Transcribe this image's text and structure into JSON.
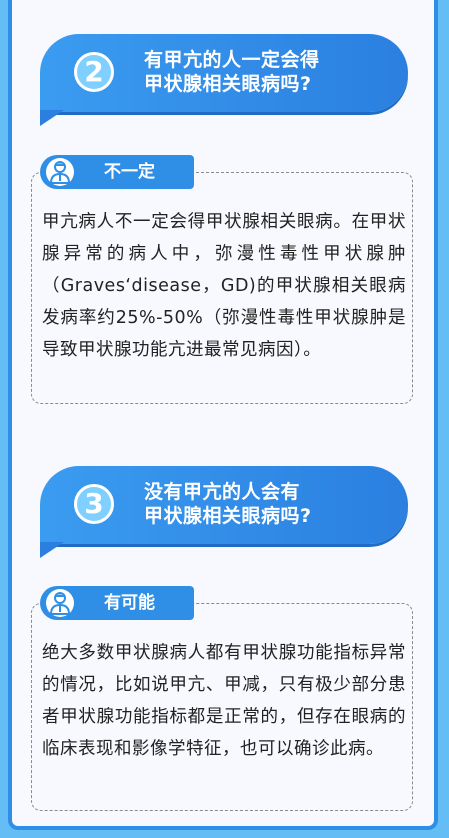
{
  "sections": [
    {
      "number": "2",
      "question_line1": "有甲亢的人一定会得",
      "question_line2": "甲状腺相关眼病吗?",
      "answer_tag": "不一定",
      "answer_text": "甲亢病人不一定会得甲状腺相关眼病。在甲状腺异常的病人中，弥漫性毒性甲状腺肿（Graves‘disease，GD)的甲状腺相关眼病发病率约25%-50%（弥漫性毒性甲状腺肿是导致甲状腺功能亢进最常见病因）。"
    },
    {
      "number": "3",
      "question_line1": "没有甲亢的人会有",
      "question_line2": "甲状腺相关眼病吗?",
      "answer_tag": "有可能",
      "answer_text": "绝大多数甲状腺病人都有甲状腺功能指标异常的情况，比如说甲亢、甲减，只有极少部分患者甲状腺功能指标都是正常的，但存在眼病的临床表现和影像学特征，也可以确诊此病。"
    }
  ],
  "icons": {
    "tag_icon": "doctor-icon"
  },
  "colors": {
    "primary": "#2f8fe6",
    "background": "#65bdf6",
    "panel": "#f7f9fe",
    "number_circle": "#7fd0ff"
  }
}
